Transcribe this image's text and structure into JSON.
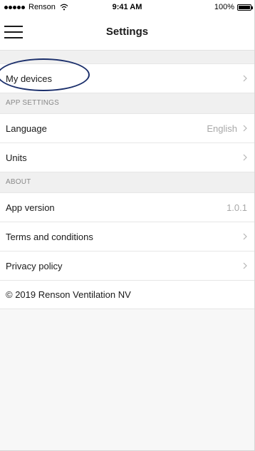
{
  "status_bar": {
    "carrier": "Renson",
    "time": "9:41 AM",
    "battery": "100%"
  },
  "nav": {
    "title": "Settings",
    "menu_icon": "hamburger-menu-icon"
  },
  "rows": {
    "my_devices": {
      "label": "My devices"
    },
    "app_settings_header": "APP SETTINGS",
    "language": {
      "label": "Language",
      "value": "English"
    },
    "units": {
      "label": "Units"
    },
    "about_header": "ABOUT",
    "app_version": {
      "label": "App version",
      "value": "1.0.1"
    },
    "terms": {
      "label": "Terms and conditions"
    },
    "privacy": {
      "label": "Privacy policy"
    },
    "copyright": {
      "label": "© 2019 Renson Ventilation NV"
    }
  },
  "colors": {
    "highlight_ellipse": "#1b2f6b",
    "secondary_text": "#a8a8a8",
    "section_header_text": "#888888"
  }
}
